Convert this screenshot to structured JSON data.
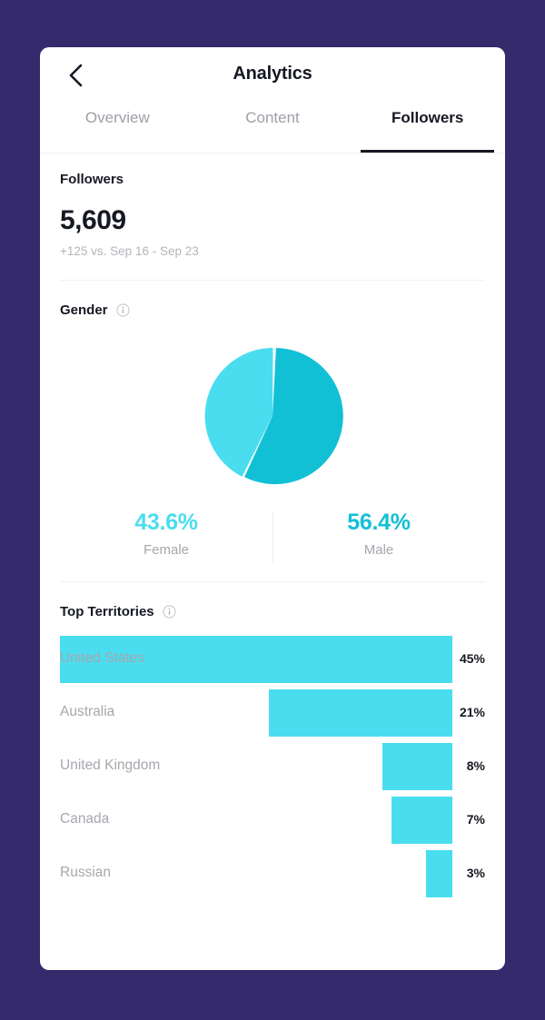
{
  "theme": {
    "background": "#352A6B",
    "card": "#ffffff",
    "text_primary": "#161823",
    "text_muted": "#a6a7ad",
    "accent_light": "#4ADDEF",
    "accent_dark": "#12C0D6"
  },
  "header": {
    "title": "Analytics",
    "back_icon": "chevron-left-icon"
  },
  "tabs": [
    {
      "label": "Overview",
      "active": false
    },
    {
      "label": "Content",
      "active": false
    },
    {
      "label": "Followers",
      "active": true
    }
  ],
  "followers": {
    "title": "Followers",
    "count": "5,609",
    "comparison": "+125 vs. Sep 16 - Sep 23"
  },
  "gender": {
    "title": "Gender",
    "info_icon": "info-circle-icon",
    "legend": [
      {
        "percent": "43.6%",
        "label": "Female",
        "color": "#4ADDEF"
      },
      {
        "percent": "56.4%",
        "label": "Male",
        "color": "#12C0D6"
      }
    ]
  },
  "territories": {
    "title": "Top Territories",
    "info_icon": "info-circle-icon",
    "rows": [
      {
        "name": "United States",
        "percent": "45%"
      },
      {
        "name": "Australia",
        "percent": "21%"
      },
      {
        "name": "United Kingdom",
        "percent": "8%"
      },
      {
        "name": "Canada",
        "percent": "7%"
      },
      {
        "name": "Russian",
        "percent": "3%"
      }
    ]
  },
  "chart_data": [
    {
      "type": "pie",
      "title": "Gender",
      "categories": [
        "Female",
        "Male"
      ],
      "values": [
        43.6,
        56.4
      ],
      "colors": [
        "#4ADDEF",
        "#12C0D6"
      ],
      "units": "percent",
      "legend": "below",
      "annotations": [
        "43.6% Female",
        "56.4% Male"
      ]
    },
    {
      "type": "bar",
      "title": "Top Territories",
      "orientation": "horizontal",
      "align": "right",
      "categories": [
        "United States",
        "Australia",
        "United Kingdom",
        "Canada",
        "Russian"
      ],
      "values": [
        45,
        21,
        8,
        7,
        3
      ],
      "value_labels": [
        "45%",
        "21%",
        "8%",
        "7%",
        "3%"
      ],
      "color": "#4ADDEF",
      "xlabel": "",
      "ylabel": "",
      "xlim": [
        0,
        45
      ],
      "grid": false,
      "legend": "none"
    }
  ]
}
